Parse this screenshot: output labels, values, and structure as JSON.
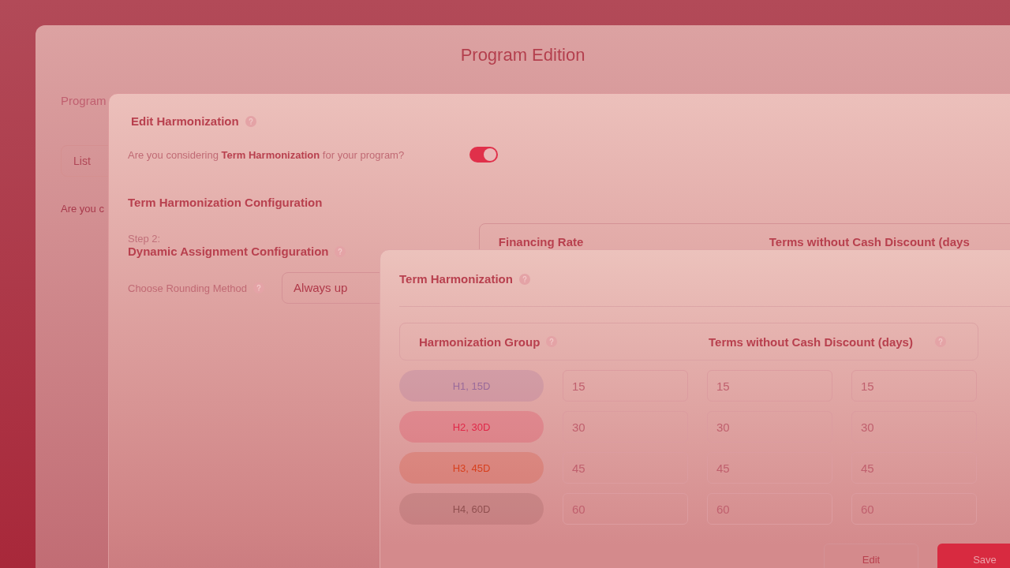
{
  "back_window": {
    "title": "Program Edition",
    "tab_label": "Program",
    "list_button": "List",
    "question": "Are you c"
  },
  "edit_panel": {
    "title": "Edit Harmonization",
    "question": "Are you considering **Term Harmonization** for your program?",
    "toggle_on": true,
    "section_title": "Term Harmonization Configuration",
    "step": "Step 2:",
    "step_title": "Dynamic Assignment Configuration",
    "rounding_label": "Choose Rounding Method",
    "rounding_value": "Always up",
    "table_columns": [
      "Financing Rate",
      "Terms without Cash Discount (days"
    ]
  },
  "term_dialog": {
    "title": "Term Harmonization",
    "columns": [
      "Harmonization Group",
      "Terms without Cash Discount (days)"
    ],
    "rows": [
      {
        "group": "H1, 15D",
        "color": "#9a6a9a",
        "values": [
          "15",
          "15",
          "15"
        ]
      },
      {
        "group": "H2, 30D",
        "color": "#e02848",
        "values": [
          "30",
          "30",
          "30"
        ]
      },
      {
        "group": "H3, 45D",
        "color": "#d8401e",
        "values": [
          "45",
          "45",
          "45"
        ]
      },
      {
        "group": "H4, 60D",
        "color": "#905050",
        "values": [
          "60",
          "60",
          "60"
        ]
      }
    ],
    "buttons": [
      {
        "label": "Edit",
        "kind": "secondary"
      },
      {
        "label": "Save",
        "kind": "primary"
      }
    ]
  }
}
